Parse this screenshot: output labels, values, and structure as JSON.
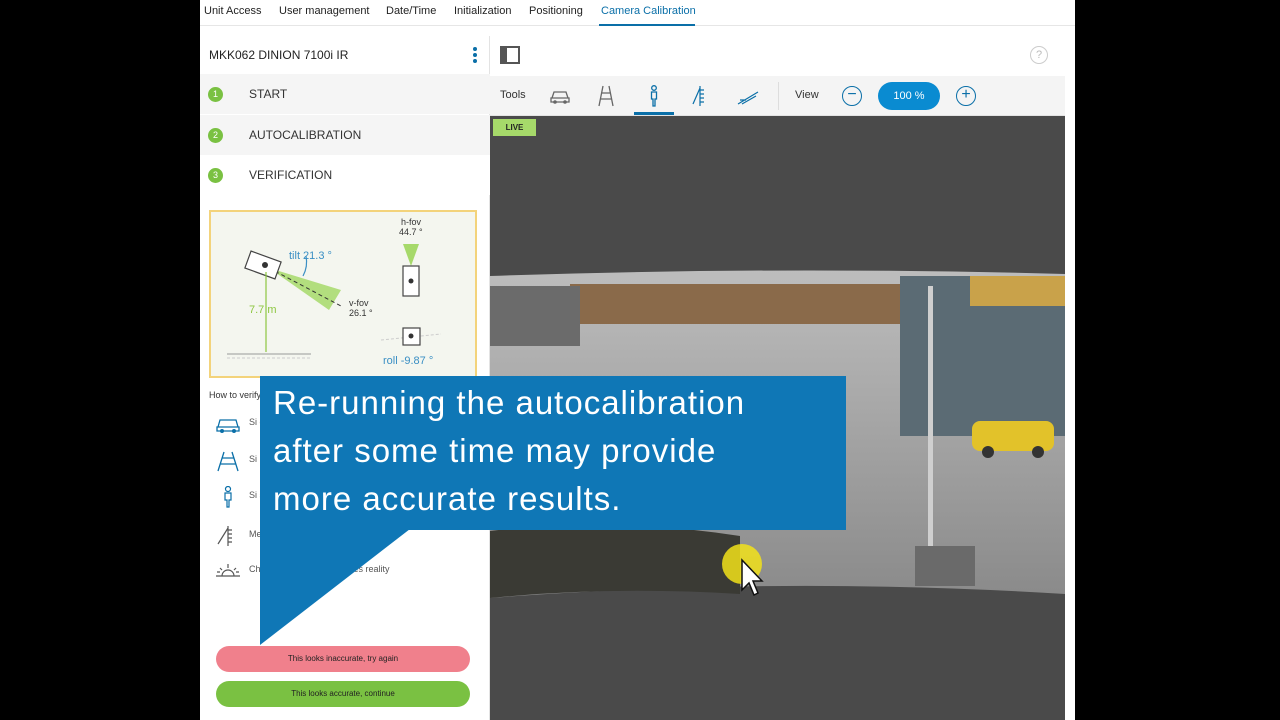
{
  "nav": {
    "tabs": [
      {
        "label": "Unit Access"
      },
      {
        "label": "User management"
      },
      {
        "label": "Date/Time"
      },
      {
        "label": "Initialization"
      },
      {
        "label": "Positioning"
      },
      {
        "label": "Camera Calibration"
      }
    ],
    "active_tab": "Camera Calibration"
  },
  "header": {
    "device_title": "MKK062 DINION 7100i IR",
    "help_label": "?"
  },
  "steps": [
    {
      "number": "1",
      "label": "START"
    },
    {
      "number": "2",
      "label": "AUTOCALIBRATION"
    },
    {
      "number": "3",
      "label": "VERIFICATION"
    }
  ],
  "diagram": {
    "tilt": "tilt 21.3 °",
    "height": "7.7 m",
    "vfov_label": "v-fov",
    "vfov_value": "26.1 °",
    "hfov_label": "h-fov",
    "hfov_value": "44.7 °",
    "roll": "roll -9.87 °"
  },
  "verify": {
    "heading": "How to verify",
    "rows": [
      {
        "icon": "car-icon",
        "text": "Si co"
      },
      {
        "icon": "road-icon",
        "text": "Si"
      },
      {
        "icon": "person-icon",
        "text": "Si sc"
      },
      {
        "icon": "ruler-icon",
        "text": "Me"
      },
      {
        "icon": "horizon-icon",
        "text": "Ch",
        "suffix": "ches reality"
      }
    ]
  },
  "buttons": {
    "retry": "This looks inaccurate, try again",
    "continue": "This looks accurate, continue"
  },
  "toolbar": {
    "tools_label": "Tools",
    "view_label": "View",
    "zoom": "100 %",
    "zoom_out": "−",
    "zoom_in": "+"
  },
  "video": {
    "live_label": "LIVE"
  },
  "overlay": {
    "lines": [
      "Re-running the autocalibration",
      "after some time may provide",
      "more accurate results."
    ]
  },
  "colors": {
    "accent": "#0a6fa8",
    "step_green": "#7ac142",
    "retry_red": "#f0808c",
    "overlay_blue": "#0f77b6"
  }
}
